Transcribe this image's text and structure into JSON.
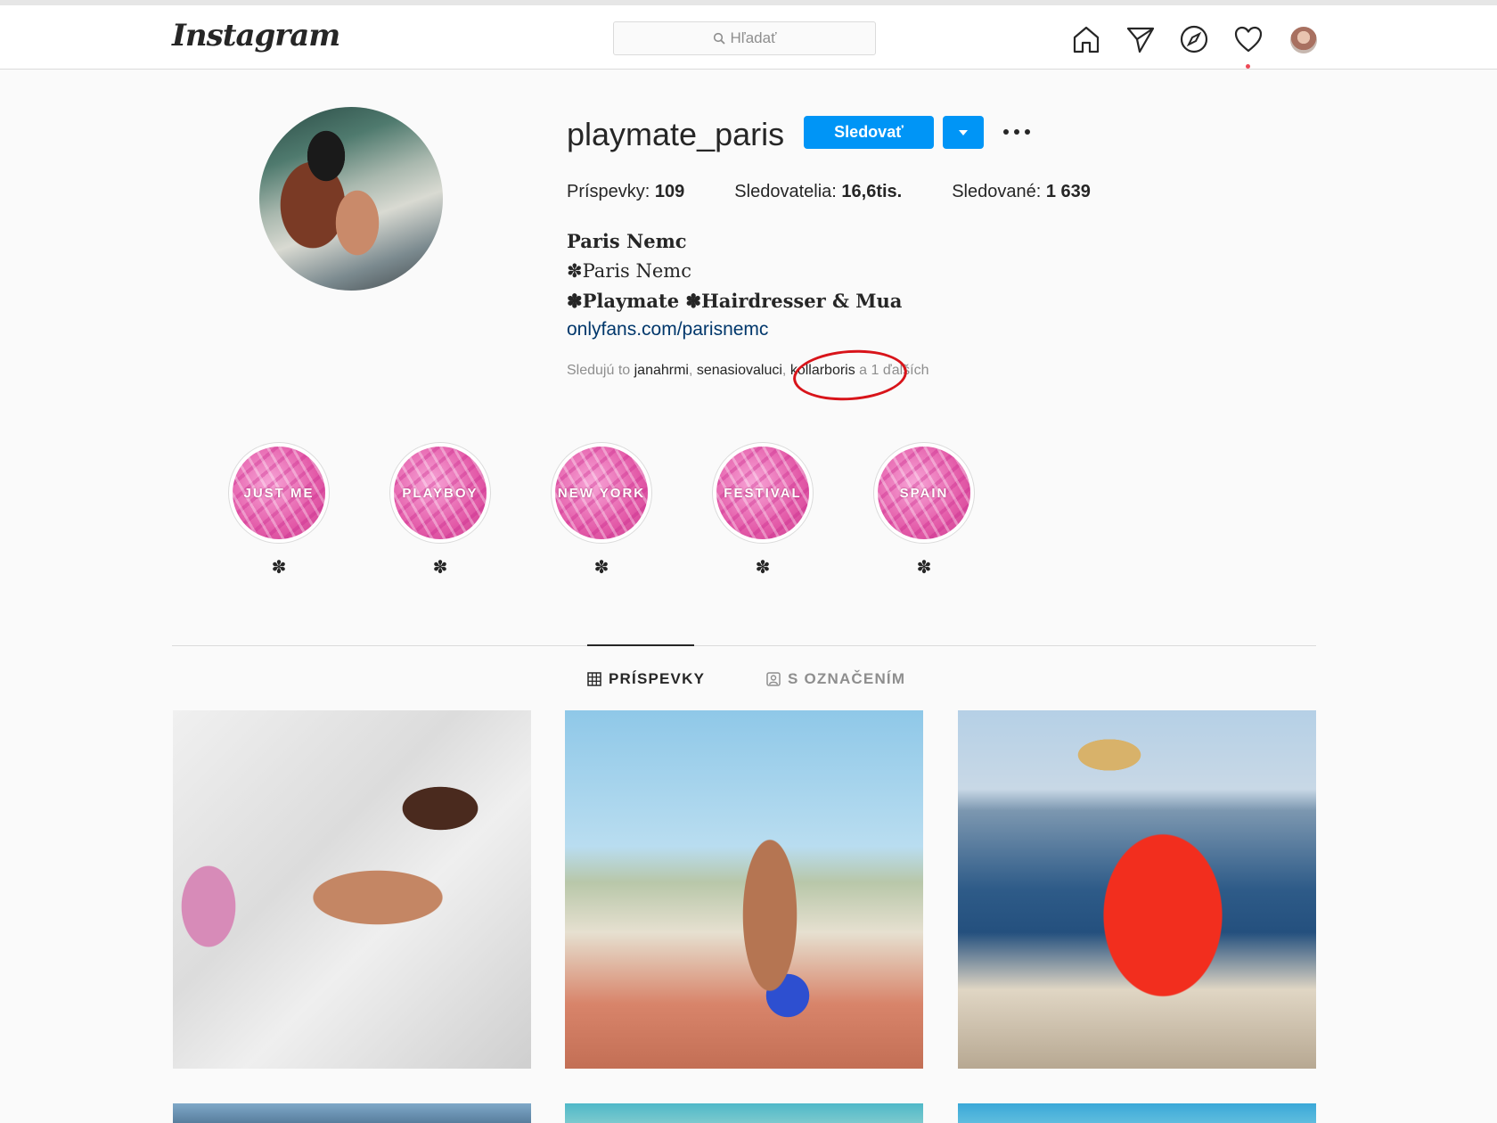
{
  "header": {
    "logo": "Instagram",
    "search_placeholder": "Hľadať",
    "icons": [
      "home-icon",
      "direct-icon",
      "explore-icon",
      "activity-heart-icon",
      "avatar"
    ]
  },
  "profile": {
    "username": "playmate_paris",
    "follow_label": "Sledovať",
    "stats": {
      "posts_label": "Príspevky:",
      "posts_value": "109",
      "followers_label": "Sledovatelia:",
      "followers_value": "16,6tis.",
      "following_label": "Sledované:",
      "following_value": "1 639"
    },
    "bio": {
      "name": "Paris Nemc",
      "line1": "✽Paris Nemc",
      "line2": "✽Playmate ✽Hairdresser & Mua",
      "link": "onlyfans.com/parisnemc"
    },
    "followed_by": {
      "prefix": "Sledujú to ",
      "user1": "janahrmi",
      "sep1": ", ",
      "user2": "senasiovaluci",
      "sep2": ", ",
      "user3": "kollarboris",
      "suffix": " a 1",
      "suffix2": " ďalších"
    }
  },
  "highlights": [
    {
      "cover_text": "JUST ME",
      "label": "✽"
    },
    {
      "cover_text": "PLAYBOY",
      "label": "✽"
    },
    {
      "cover_text": "NEW YORK",
      "label": "✽"
    },
    {
      "cover_text": "FESTIVAL",
      "label": "✽"
    },
    {
      "cover_text": "SPAIN",
      "label": "✽"
    }
  ],
  "tabs": {
    "posts": "PRÍSPEVKY",
    "tagged": "S OZNAČENÍM"
  },
  "colors": {
    "accent": "#0095f6",
    "annotation": "#d8141a",
    "link": "#00376b"
  }
}
